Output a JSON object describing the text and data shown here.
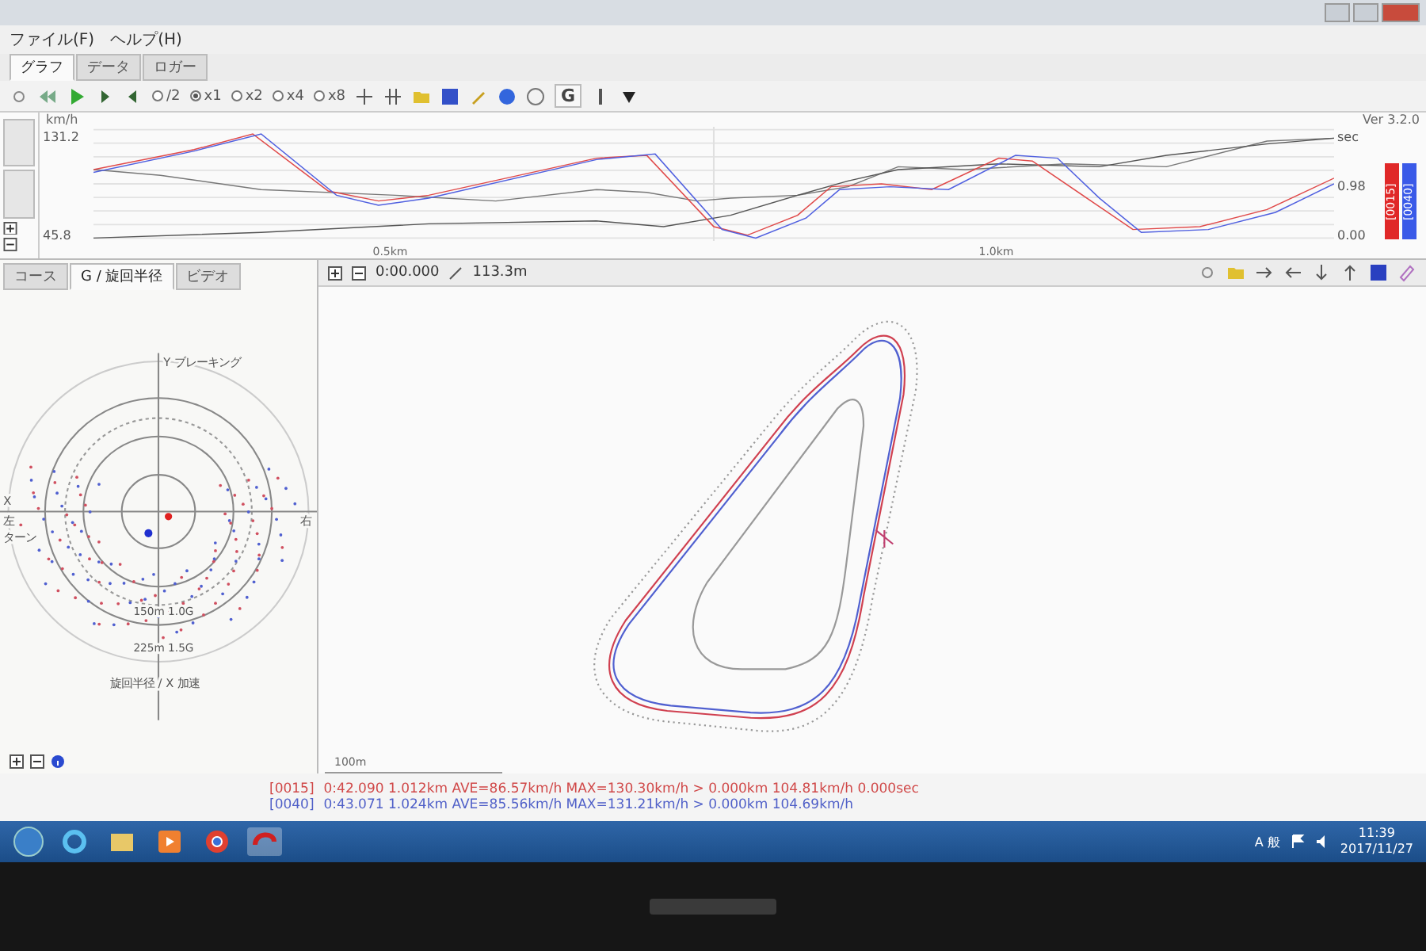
{
  "menu": [
    "ファイル(F)",
    "ヘルプ(H)"
  ],
  "tabs": [
    {
      "label": "グラフ",
      "selected": true
    },
    {
      "label": "データ",
      "selected": false
    },
    {
      "label": "ロガー",
      "selected": false
    }
  ],
  "toolbar": {
    "zoom_options": [
      {
        "label": "/2",
        "selected": false
      },
      {
        "label": "x1",
        "selected": true
      },
      {
        "label": "x2",
        "selected": false
      },
      {
        "label": "x4",
        "selected": false
      },
      {
        "label": "x8",
        "selected": false
      }
    ],
    "g_button": "G"
  },
  "graph": {
    "unit": "km/h",
    "y_max": "131.2",
    "y_min": "45.8",
    "x_ticks": [
      "0.5km",
      "1.0km"
    ],
    "right_unit": "sec",
    "right_max": "0.98",
    "right_min": "0.00",
    "version": "Ver 3.2.0",
    "lap_bars": [
      {
        "label": "[0015]",
        "color": "#e02828"
      },
      {
        "label": "[0040]",
        "color": "#3a5ae8"
      }
    ]
  },
  "left_panel": {
    "tabs": [
      {
        "label": "コース",
        "selected": false
      },
      {
        "label": "G / 旋回半径",
        "selected": true
      },
      {
        "label": "ビデオ",
        "selected": false
      }
    ],
    "g_plot": {
      "y_label": "Y ブレーキング",
      "x_label": "X",
      "left_label": "左",
      "left_sub": "ターン",
      "right_label": "右",
      "rings": [
        "150m 1.0G",
        "225m 1.5G"
      ],
      "bottom_label": "旋回半径 / X 加速"
    }
  },
  "map": {
    "time": "0:00.000",
    "distance": "113.3m",
    "scale": "100m"
  },
  "laps": [
    {
      "id": "[0015]",
      "summary": "0:42.090 1.012km AVE=86.57km/h MAX=130.30km/h > 0.000km 104.81km/h 0.000sec",
      "color": "#d04848"
    },
    {
      "id": "[0040]",
      "summary": "0:43.071 1.024km AVE=85.56km/h MAX=131.21km/h > 0.000km 104.69km/h",
      "color": "#5060c8"
    }
  ],
  "taskbar": {
    "ime": "A 般",
    "time": "11:39",
    "date": "2017/11/27"
  }
}
